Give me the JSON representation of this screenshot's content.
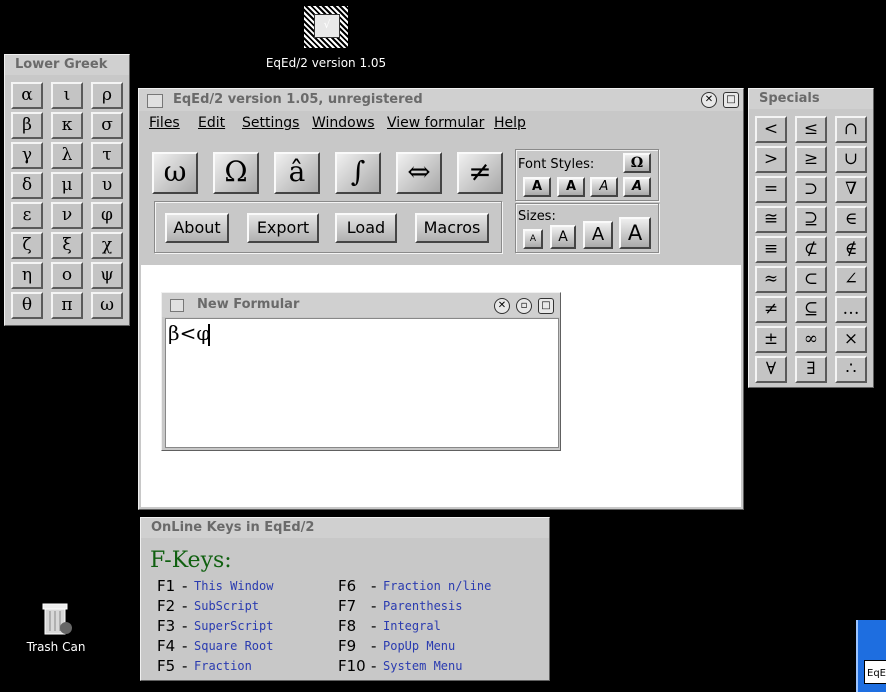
{
  "desktop": {
    "app_icon_label": "EqEd/2 version 1.05",
    "trash_label": "Trash Can"
  },
  "lower_greek": {
    "title": "Lower Greek",
    "symbols": [
      "α",
      "ι",
      "ρ",
      "β",
      "κ",
      "σ",
      "γ",
      "λ",
      "τ",
      "δ",
      "μ",
      "υ",
      "ε",
      "ν",
      "φ",
      "ζ",
      "ξ",
      "χ",
      "η",
      "ο",
      "ψ",
      "θ",
      "π",
      "ω"
    ]
  },
  "specials": {
    "title": "Specials",
    "symbols": [
      "<",
      "≤",
      "∩",
      ">",
      "≥",
      "∪",
      "=",
      "⊃",
      "∇",
      "≅",
      "⊇",
      "∈",
      "≡",
      "⊄",
      "∉",
      "≈",
      "⊂",
      "∠",
      "≠",
      "⊆",
      "…",
      "±",
      "∞",
      "×",
      "∀",
      "∃",
      "∴"
    ]
  },
  "main": {
    "title": "EqEd/2 version 1.05, unregistered",
    "menu": [
      "Files",
      "Edit",
      "Settings",
      "Windows",
      "View formular",
      "Help"
    ],
    "big_buttons": [
      "ω",
      "Ω",
      "â",
      "∫",
      "⇔",
      "≠"
    ],
    "action_buttons": [
      "About",
      "Export",
      "Load",
      "Macros"
    ],
    "font_styles_label": "Font Styles:",
    "font_style_omega": "Ω",
    "font_style_buttons": [
      "A",
      "A",
      "A",
      "A"
    ],
    "sizes_label": "Sizes:",
    "size_buttons": [
      "A",
      "A",
      "A",
      "A"
    ]
  },
  "formular": {
    "title": "New Formular",
    "content": "β<φ"
  },
  "keys": {
    "title": "OnLine Keys in EqEd/2",
    "heading": "F-Keys:",
    "left": [
      {
        "key": "F1",
        "desc": "This Window"
      },
      {
        "key": "F2",
        "desc": "SubScript"
      },
      {
        "key": "F3",
        "desc": "SuperScript"
      },
      {
        "key": "F4",
        "desc": "Square Root"
      },
      {
        "key": "F5",
        "desc": "Fraction"
      }
    ],
    "right": [
      {
        "key": "F6",
        "desc": "Fraction n/line"
      },
      {
        "key": "F7",
        "desc": "Parenthesis"
      },
      {
        "key": "F8",
        "desc": "Integral"
      },
      {
        "key": "F9",
        "desc": "PopUp Menu"
      },
      {
        "key": "F10",
        "desc": "System Menu"
      }
    ]
  },
  "taskbar_fragment": "EqEd"
}
